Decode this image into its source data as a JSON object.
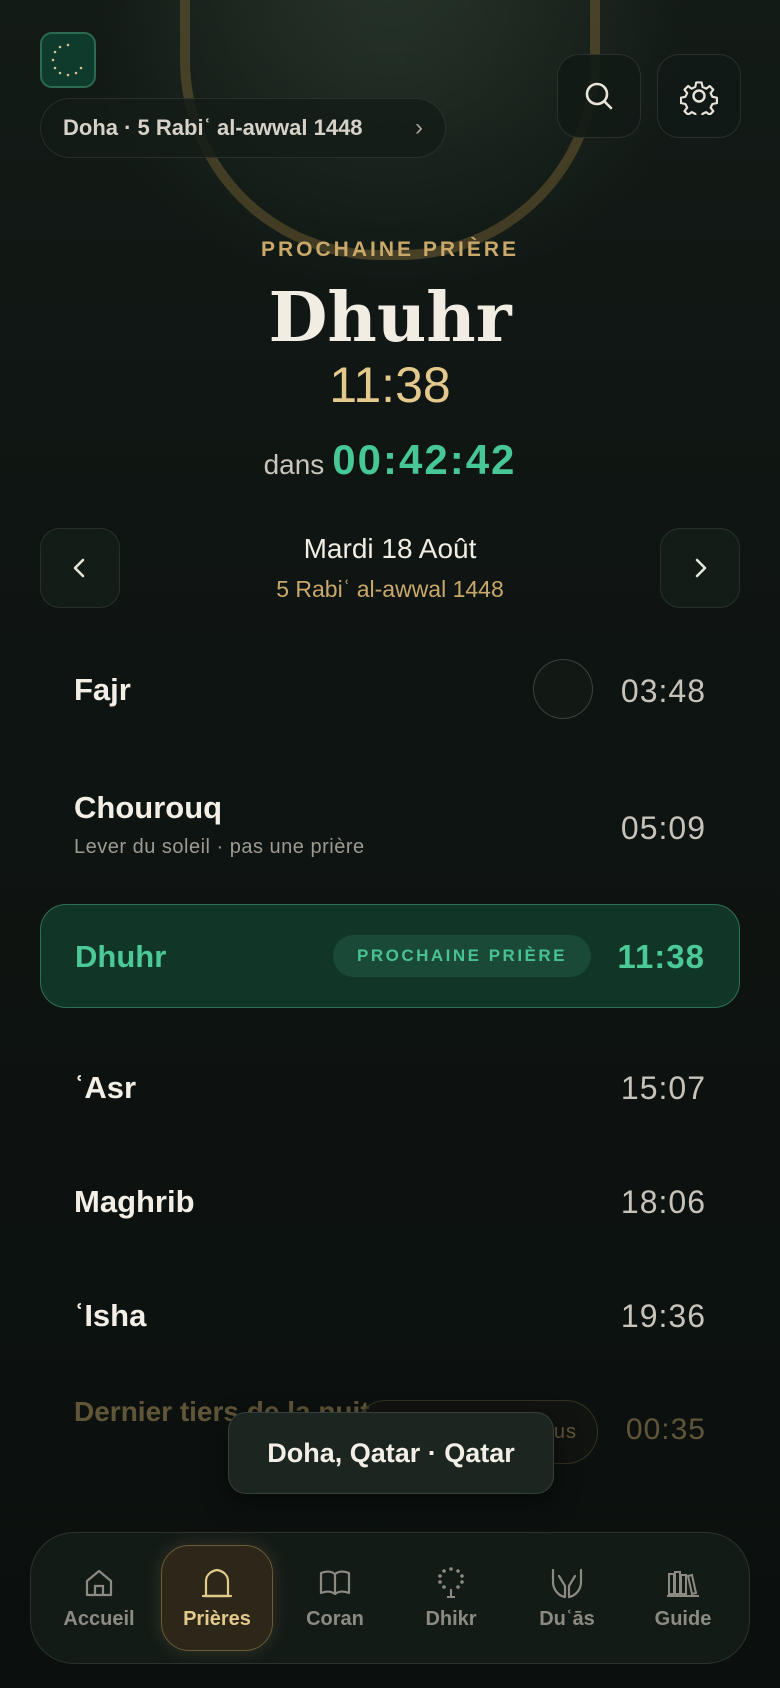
{
  "header": {
    "location_label": "Doha · 5 Rabiʿ al-awwal 1448",
    "chevron": "›"
  },
  "hero": {
    "next_label": "PROCHAINE PRIÈRE",
    "next_name": "Dhuhr",
    "next_time": "11:38",
    "countdown_prefix": "dans",
    "countdown_value": "00:42:42"
  },
  "date_nav": {
    "gregorian": "Mardi 18 Août",
    "hijri": "5 Rabiʿ al-awwal 1448"
  },
  "prayers": [
    {
      "name": "Fajr",
      "time": "03:48"
    },
    {
      "name": "Chourouq",
      "subtitle": "Lever du soleil · pas une prière",
      "time": "05:09"
    },
    {
      "name": "Dhuhr",
      "time": "11:38",
      "badge": "PROCHAINE PRIÈRE"
    },
    {
      "name": "ʿAsr",
      "time": "15:07"
    },
    {
      "name": "Maghrib",
      "time": "18:06"
    },
    {
      "name": "ʿIsha",
      "time": "19:36"
    },
    {
      "name": "Dernier tiers de la nuit",
      "time": "00:35",
      "badge_partial": "us"
    }
  ],
  "toast": "Doha, Qatar · Qatar",
  "tabs": [
    {
      "label": "Accueil",
      "icon": "home-icon"
    },
    {
      "label": "Prières",
      "icon": "mosque-icon",
      "active": true
    },
    {
      "label": "Coran",
      "icon": "book-icon"
    },
    {
      "label": "Dhikr",
      "icon": "prayer-beads-icon"
    },
    {
      "label": "Duʿās",
      "icon": "praying-hands-icon"
    },
    {
      "label": "Guide",
      "icon": "library-icon"
    }
  ],
  "colors": {
    "accent_green": "#4bc996",
    "accent_gold": "#c9a86a",
    "background": "#0d1210"
  }
}
